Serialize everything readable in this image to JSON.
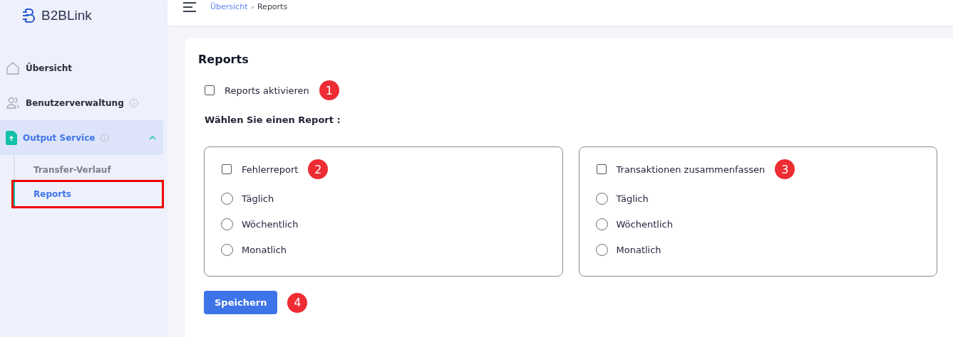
{
  "logo": {
    "text": "B2BLink"
  },
  "sidebar": {
    "items": [
      {
        "label": "Übersicht",
        "info": false,
        "selected": false
      },
      {
        "label": "Benutzerverwaltung",
        "info": true,
        "selected": false
      },
      {
        "label": "Output Service",
        "info": true,
        "selected": true,
        "expanded": true,
        "children": [
          {
            "label": "Transfer-Verlauf",
            "selected": false,
            "highlighted": false
          },
          {
            "label": "Reports",
            "selected": true,
            "highlighted": true
          }
        ]
      }
    ]
  },
  "breadcrumb": {
    "items": [
      "Übersicht",
      "Reports"
    ],
    "separator": "»"
  },
  "card": {
    "title": "Reports",
    "activate": {
      "label": "Reports aktivieren",
      "checked": false,
      "badge": "1"
    },
    "choose_label": "Wählen Sie einen Report :",
    "reports": [
      {
        "label": "Fehlerreport",
        "checked": false,
        "badge": "2",
        "options": [
          {
            "label": "Täglich",
            "selected": false
          },
          {
            "label": "Wöchentlich",
            "selected": false
          },
          {
            "label": "Monatlich",
            "selected": false
          }
        ]
      },
      {
        "label": "Transaktionen zusammenfassen",
        "checked": false,
        "badge": "3",
        "options": [
          {
            "label": "Täglich",
            "selected": false
          },
          {
            "label": "Wöchentlich",
            "selected": false
          },
          {
            "label": "Monatlich",
            "selected": false
          }
        ]
      }
    ],
    "save": {
      "label": "Speichern",
      "badge": "4"
    }
  }
}
